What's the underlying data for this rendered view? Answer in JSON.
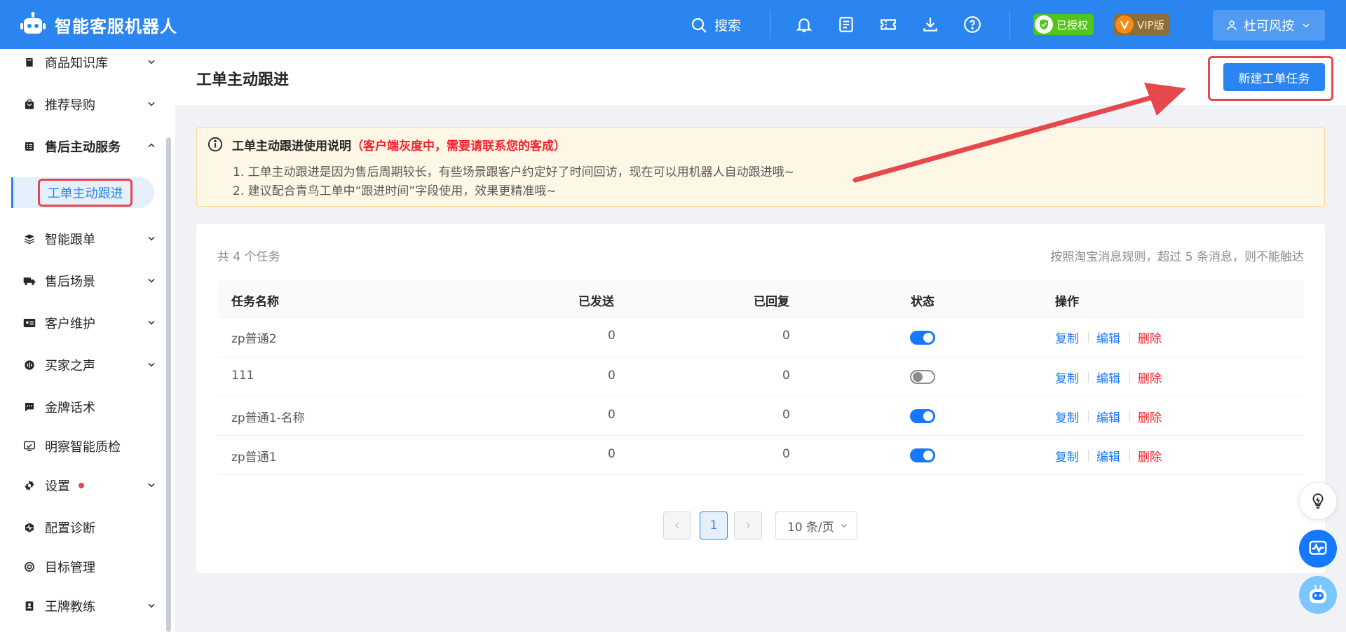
{
  "header": {
    "app_title": "智能客服机器人",
    "search_label": "搜索",
    "auth_badge": "已授权",
    "vip_badge": "VIP版",
    "user_name": "杜可风按"
  },
  "sidebar": {
    "items": [
      {
        "label": "商品知识库"
      },
      {
        "label": "推荐导购"
      },
      {
        "label": "售后主动服务"
      },
      {
        "label": "工单主动跟进"
      },
      {
        "label": "智能跟单"
      },
      {
        "label": "售后场景"
      },
      {
        "label": "客户维护"
      },
      {
        "label": "买家之声"
      },
      {
        "label": "金牌话术"
      },
      {
        "label": "明察智能质检"
      },
      {
        "label": "设置"
      },
      {
        "label": "配置诊断"
      },
      {
        "label": "目标管理"
      },
      {
        "label": "王牌教练"
      }
    ]
  },
  "page": {
    "title": "工单主动跟进",
    "new_button": "新建工单任务"
  },
  "notice": {
    "title": "工单主动跟进使用说明",
    "warning": "（客户端灰度中，需要请联系您的客成）",
    "line1": "1. 工单主动跟进是因为售后周期较长，有些场景跟客户约定好了时间回访，现在可以用机器人自动跟进哦~",
    "line2": "2. 建议配合青鸟工单中“跟进时间”字段使用，效果更精准哦~"
  },
  "table": {
    "count_text": "共 4 个任务",
    "rule_text": "按照淘宝消息规则，超过 5 条消息，则不能触达",
    "columns": [
      "任务名称",
      "已发送",
      "已回复",
      "状态",
      "操作"
    ],
    "rows": [
      {
        "name": "zp普通2",
        "sent": "0",
        "replied": "0",
        "enabled": true
      },
      {
        "name": "111",
        "sent": "0",
        "replied": "0",
        "enabled": false
      },
      {
        "name": "zp普通1-名称",
        "sent": "0",
        "replied": "0",
        "enabled": true
      },
      {
        "name": "zp普通1",
        "sent": "0",
        "replied": "0",
        "enabled": true
      }
    ],
    "actions": {
      "copy": "复制",
      "edit": "编辑",
      "delete": "删除"
    }
  },
  "pagination": {
    "current_page": "1",
    "page_size": "10 条/页"
  },
  "colors": {
    "primary": "#2b85f0",
    "danger": "#f5222d",
    "annotation": "#e5484d"
  }
}
